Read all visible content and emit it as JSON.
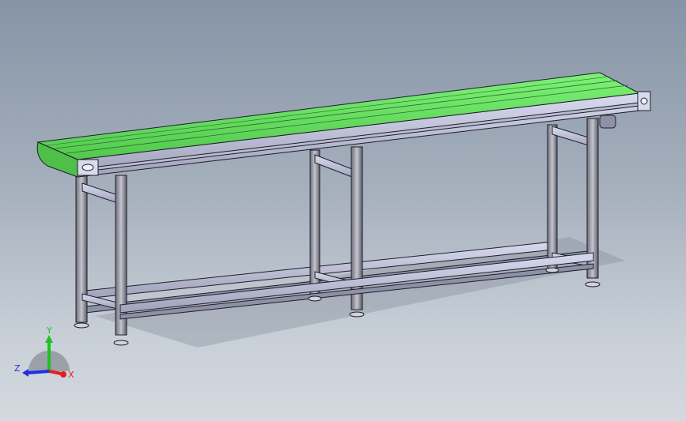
{
  "viewport": {
    "background_top": "#8594a6",
    "background_bottom": "#d4d9df"
  },
  "model": {
    "belt_color": "#6fe26a",
    "frame_color": "#c9cbe0",
    "leg_color": "#a9aab5",
    "outline_color": "#1e1e28"
  },
  "triad": {
    "x_label": "X",
    "y_label": "Y",
    "z_label": "Z",
    "x_color": "#e02020",
    "y_color": "#20c020",
    "z_color": "#2030e0"
  }
}
